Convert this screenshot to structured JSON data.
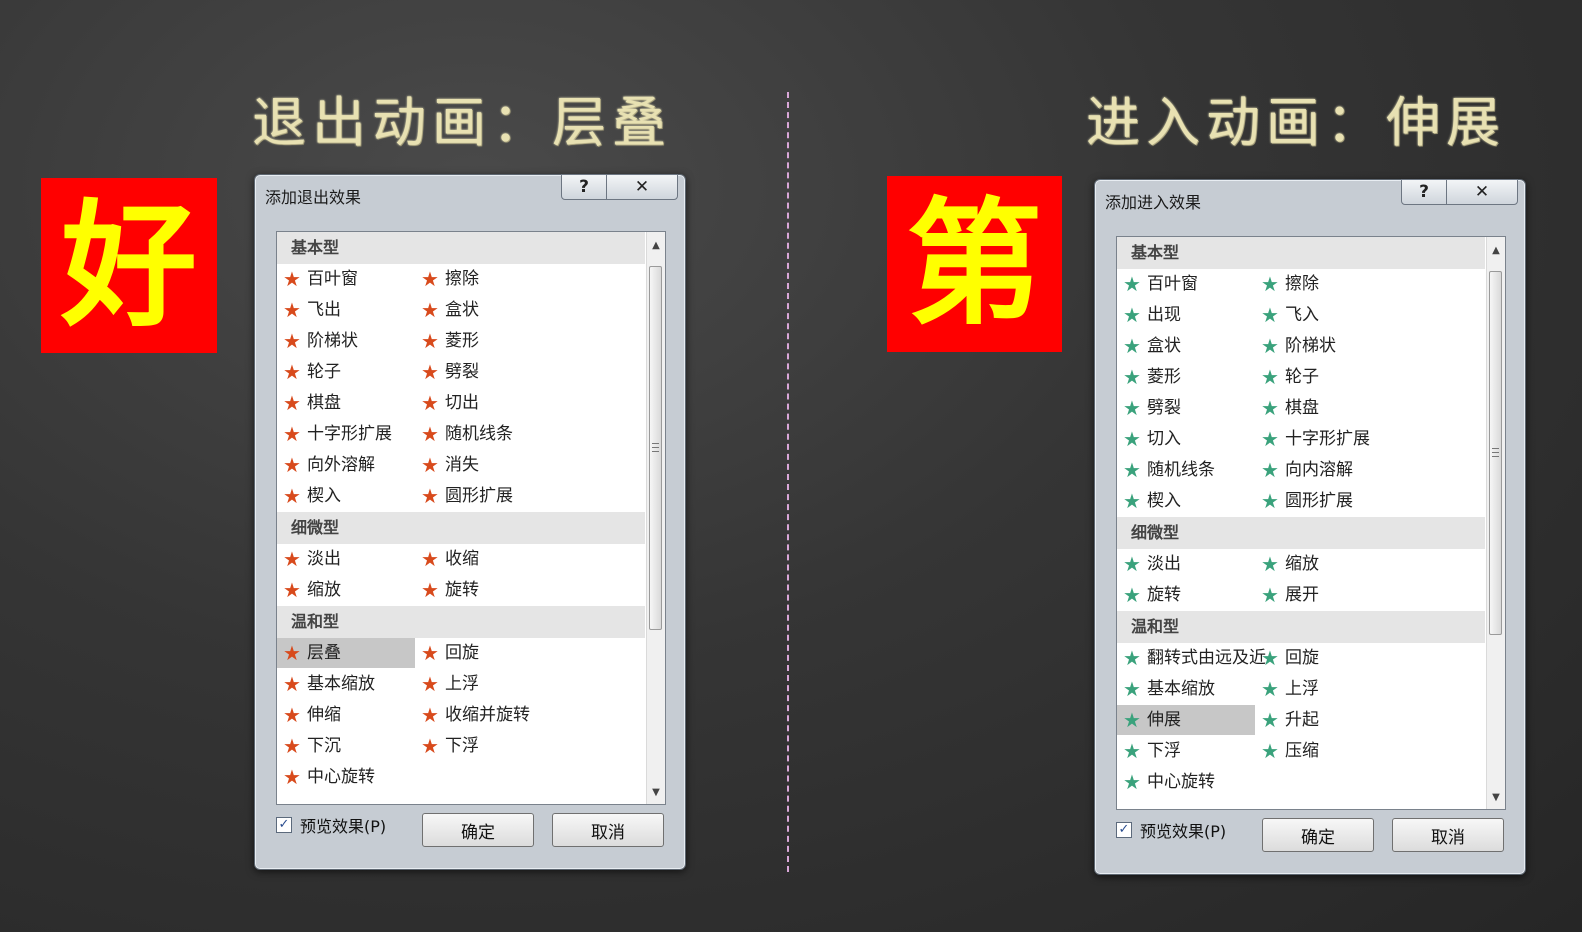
{
  "left_title": "退出动画：层叠",
  "right_title": "进入动画：伸展",
  "left_badge": "好",
  "right_badge": "第",
  "colors": {
    "badge_bg": "#ff0000",
    "badge_text": "#ffff00",
    "exit_star": "#d84a1c",
    "enter_star": "#3aa27c"
  },
  "icons": {
    "star": "★",
    "help": "?",
    "close": "✕",
    "scroll_up": "▲",
    "scroll_down": "▼",
    "check": "✓"
  },
  "exit_dialog": {
    "title": "添加退出效果",
    "help_label": "?",
    "close_label": "✕",
    "groups": [
      {
        "name": "基本型",
        "items": [
          "百叶窗",
          "擦除",
          "飞出",
          "盒状",
          "阶梯状",
          "菱形",
          "轮子",
          "劈裂",
          "棋盘",
          "切出",
          "十字形扩展",
          "随机线条",
          "向外溶解",
          "消失",
          "楔入",
          "圆形扩展"
        ]
      },
      {
        "name": "细微型",
        "items": [
          "淡出",
          "收缩",
          "缩放",
          "旋转"
        ]
      },
      {
        "name": "温和型",
        "items": [
          "层叠",
          "回旋",
          "基本缩放",
          "上浮",
          "伸缩",
          "收缩并旋转",
          "下沉",
          "下浮",
          "中心旋转"
        ]
      }
    ],
    "selected": "层叠",
    "preview_label": "预览效果(P)",
    "preview_checked": true,
    "ok_label": "确定",
    "cancel_label": "取消"
  },
  "enter_dialog": {
    "title": "添加进入效果",
    "help_label": "?",
    "close_label": "✕",
    "groups": [
      {
        "name": "基本型",
        "items": [
          "百叶窗",
          "擦除",
          "出现",
          "飞入",
          "盒状",
          "阶梯状",
          "菱形",
          "轮子",
          "劈裂",
          "棋盘",
          "切入",
          "十字形扩展",
          "随机线条",
          "向内溶解",
          "楔入",
          "圆形扩展"
        ]
      },
      {
        "name": "细微型",
        "items": [
          "淡出",
          "缩放",
          "旋转",
          "展开"
        ]
      },
      {
        "name": "温和型",
        "items": [
          "翻转式由远及近",
          "回旋",
          "基本缩放",
          "上浮",
          "伸展",
          "升起",
          "下浮",
          "压缩",
          "中心旋转"
        ]
      }
    ],
    "selected": "伸展",
    "preview_label": "预览效果(P)",
    "preview_checked": true,
    "ok_label": "确定",
    "cancel_label": "取消"
  }
}
